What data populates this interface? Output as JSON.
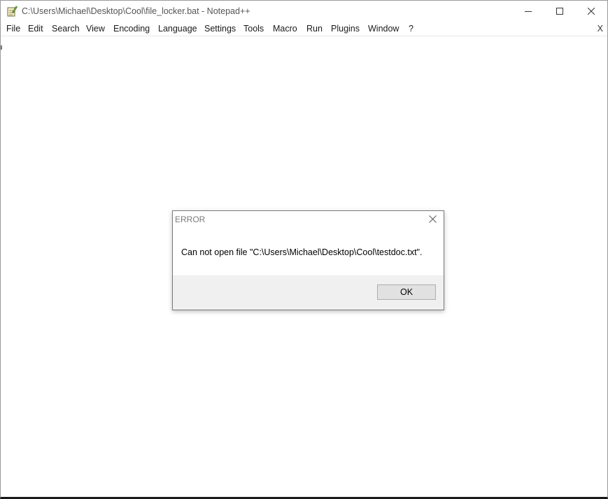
{
  "window": {
    "title": "C:\\Users\\Michael\\Desktop\\Cool\\file_locker.bat - Notepad++",
    "icon": "notepad-plus-plus-icon"
  },
  "controls": {
    "minimize": "minimize-icon",
    "maximize": "maximize-icon",
    "close": "close-icon"
  },
  "menu": {
    "items": [
      "File",
      "Edit",
      "Search",
      "View",
      "Encoding",
      "Language",
      "Settings",
      "Tools",
      "Macro",
      "Run",
      "Plugins",
      "Window",
      "?"
    ],
    "close_document": "X"
  },
  "dialog": {
    "title": "ERROR",
    "message": "Can not open file \"C:\\Users\\Michael\\Desktop\\Cool\\testdoc.txt\".",
    "ok_label": "OK"
  }
}
